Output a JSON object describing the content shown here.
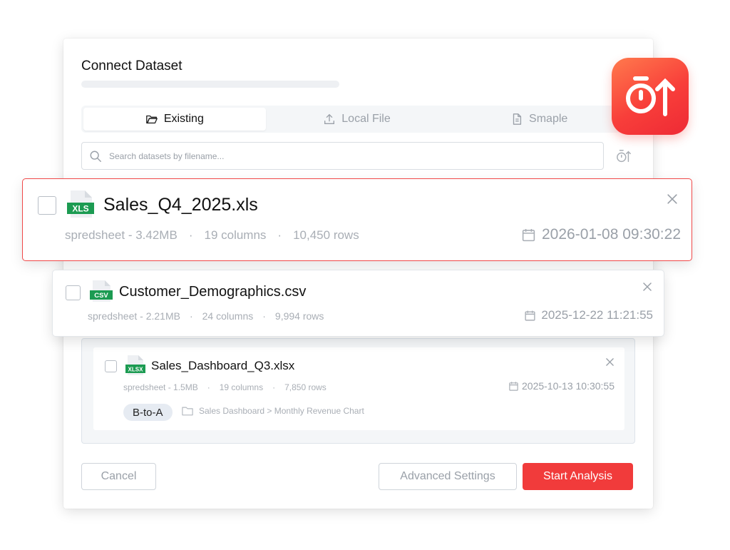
{
  "dialog": {
    "title": "Connect Dataset",
    "tabs": [
      {
        "label": "Existing",
        "icon": "folder-open-icon",
        "active": true
      },
      {
        "label": "Local File",
        "icon": "upload-icon",
        "active": false
      },
      {
        "label": "Smaple",
        "icon": "document-icon",
        "active": false
      }
    ],
    "search": {
      "placeholder": "Search datasets by filename..."
    },
    "buttons": {
      "cancel": "Cancel",
      "advanced": "Advanced Settings",
      "start": "Start Analysis"
    }
  },
  "files": [
    {
      "badge": "XLS",
      "name": "Sales_Q4_2025.xls",
      "type": "spredsheet - 3.42MB",
      "columns": "19 columns",
      "rows": "10,450 rows",
      "date": "2026-01-08 09:30:22"
    },
    {
      "badge": "CSV",
      "name": "Customer_Demographics.csv",
      "type": "spredsheet - 2.21MB",
      "columns": "24 columns",
      "rows": "9,994 rows",
      "date": "2025-12-22 11:21:55"
    },
    {
      "badge": "XLSX",
      "name": "Sales_Dashboard_Q3.xlsx",
      "type": "spredsheet - 1.5MB",
      "columns": "19 columns",
      "rows": "7,850 rows",
      "date": "2025-10-13 10:30:55",
      "tag": "B-to-A",
      "path": "Sales Dashboard > Monthly Revenue Chart"
    }
  ],
  "meta_separator": "·",
  "colors": {
    "accent": "#f13b3b",
    "file_green": "#1c9b52",
    "highlight_border": "#f04848"
  }
}
